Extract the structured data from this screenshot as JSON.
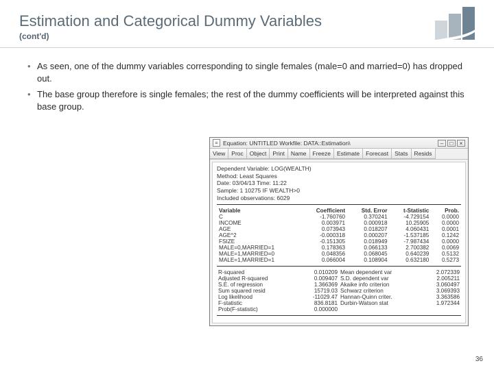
{
  "header": {
    "title": "Estimation and Categorical Dummy Variables",
    "subtitle": "(cont'd)"
  },
  "bullets": [
    "As seen, one of the dummy variables corresponding to single females (male=0 and married=0) has dropped out.",
    "The base group therefore is single females; the rest of the dummy coefficients will be interpreted against this base group."
  ],
  "window": {
    "title": "Equation: UNTITLED   Workfile: DATA::Estimation\\",
    "toolbar": [
      "View",
      "Proc",
      "Object",
      "Print",
      "Name",
      "Freeze",
      "Estimate",
      "Forecast",
      "Stats",
      "Resids"
    ],
    "meta": {
      "dep": "Dependent Variable: LOG(WEALTH)",
      "method": "Method: Least Squares",
      "date": "Date: 03/04/13   Time: 11:22",
      "sample": "Sample: 1 10275 IF WEALTH>0",
      "obs": "Included observations: 6029"
    },
    "headers": [
      "Variable",
      "Coefficient",
      "Std. Error",
      "t-Statistic",
      "Prob."
    ],
    "rows": [
      {
        "v": "C",
        "c": "-1.760760",
        "s": "0.370241",
        "t": "-4.729154",
        "p": "0.0000"
      },
      {
        "v": "INCOME",
        "c": "0.003971",
        "s": "0.000918",
        "t": "10.25905",
        "p": "0.0000"
      },
      {
        "v": "AGE",
        "c": "0.073943",
        "s": "0.018207",
        "t": "4.060431",
        "p": "0.0001"
      },
      {
        "v": "AGE^2",
        "c": "-0.000318",
        "s": "0.000207",
        "t": "-1.537185",
        "p": "0.1242"
      },
      {
        "v": "FSIZE",
        "c": "-0.151305",
        "s": "0.018949",
        "t": "-7.987434",
        "p": "0.0000"
      },
      {
        "v": "MALE=0,MARRIED=1",
        "c": "0.178363",
        "s": "0.066133",
        "t": "2.700382",
        "p": "0.0069"
      },
      {
        "v": "MALE=1,MARRIED=0",
        "c": "0.048356",
        "s": "0.068045",
        "t": "0.640239",
        "p": "0.5132"
      },
      {
        "v": "MALE=1,MARRIED=1",
        "c": "0.066004",
        "s": "0.108904",
        "t": "0.632180",
        "p": "0.5273"
      }
    ],
    "statsL": [
      {
        "k": "R-squared",
        "v": "0.010209"
      },
      {
        "k": "Adjusted R-squared",
        "v": "0.009407"
      },
      {
        "k": "S.E. of regression",
        "v": "1.366369"
      },
      {
        "k": "Sum squared resid",
        "v": "15719.03"
      },
      {
        "k": "Log likelihood",
        "v": "-11029.47"
      },
      {
        "k": "F-statistic",
        "v": "836.8181"
      },
      {
        "k": "Prob(F-statistic)",
        "v": "0.000000"
      }
    ],
    "statsR": [
      {
        "k": "Mean dependent var",
        "v": "2.072339"
      },
      {
        "k": "S.D. dependent var",
        "v": "2.005211"
      },
      {
        "k": "Akaike info criterion",
        "v": "3.060497"
      },
      {
        "k": "Schwarz criterion",
        "v": "3.069393"
      },
      {
        "k": "Hannan-Quinn criter.",
        "v": "3.363586"
      },
      {
        "k": "Durbin-Watson stat",
        "v": "1.972344"
      }
    ]
  },
  "pagenum": "36"
}
